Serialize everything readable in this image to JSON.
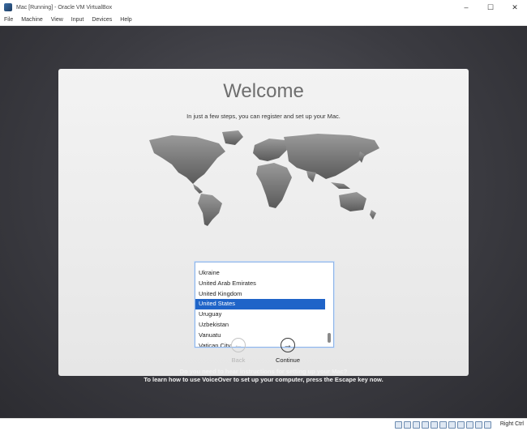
{
  "window": {
    "title": "Mac [Running] - Oracle VM VirtualBox",
    "minimize_glyph": "–",
    "maximize_glyph": "☐",
    "close_glyph": "✕"
  },
  "menu": [
    "File",
    "Machine",
    "View",
    "Input",
    "Devices",
    "Help"
  ],
  "setup": {
    "title": "Welcome",
    "subtitle": "In just a few steps, you can register and set up your Mac.",
    "countries": [
      "Ukraine",
      "United Arab Emirates",
      "United Kingdom",
      "United States",
      "Uruguay",
      "Uzbekistan",
      "Vanuatu",
      "Vatican City"
    ],
    "selected_country": "United States",
    "back_label": "Back",
    "back_glyph": "←",
    "continue_label": "Continue",
    "continue_glyph": "→",
    "voiceover_line1": "Do you need to hear instructions for setting up your Mac?",
    "voiceover_line2": "To learn how to use VoiceOver to set up your computer, press the Escape key now."
  },
  "statusbar": {
    "host_key": "Right Ctrl",
    "icons": [
      "hard-disk-icon",
      "optical-drive-icon",
      "audio-icon",
      "network-icon",
      "usb-icon",
      "shared-folders-icon",
      "display-icon",
      "video-capture-icon",
      "cpu-icon",
      "mouse-integration-icon",
      "keyboard-capture-icon"
    ]
  },
  "colors": {
    "selection": "#1f64c8",
    "vm_background": "#3b3b41"
  }
}
